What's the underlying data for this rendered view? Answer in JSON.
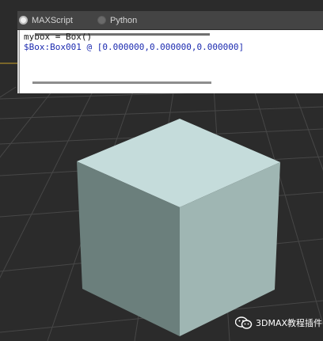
{
  "listener": {
    "tabs": [
      {
        "label": "MAXScript",
        "selected": true
      },
      {
        "label": "Python",
        "selected": false
      }
    ],
    "input_line": "mybox = Box()",
    "output_line": "$Box:Box001 @ [0.000000,0.000000,0.000000]"
  },
  "viewport": {
    "object": "box",
    "colors": {
      "background": "#2b2b2b",
      "grid": "#4a4a4a",
      "box_top": "#c5dcdb",
      "box_left": "#6b7f7c",
      "box_right": "#9fb6b3",
      "output_text": "#1c2bb0"
    }
  },
  "watermark": {
    "icon": "wechat-icon",
    "text": "3DMAX教程插件"
  }
}
